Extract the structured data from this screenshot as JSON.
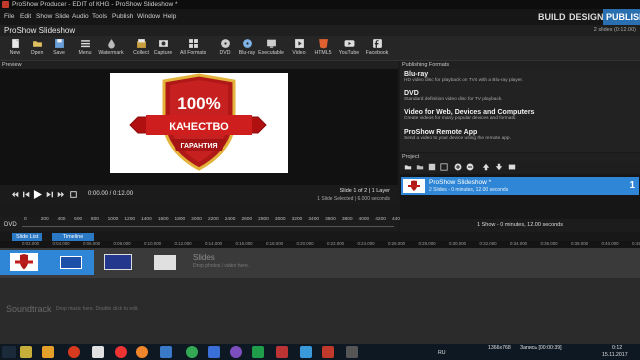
{
  "window": {
    "title": "ProShow Producer - EDIT of КНG - ProShow Slideshow *"
  },
  "menu": {
    "items": [
      "File",
      "Edit",
      "Show",
      "Slide",
      "Audio",
      "Tools",
      "Publish",
      "Window",
      "Help"
    ],
    "modes": [
      "BUILD",
      "DESIGN",
      "PUBLISH"
    ],
    "active_mode": "PUBLISH"
  },
  "project": {
    "name": "ProShow Slideshow",
    "slide_count": "2 slides (0:12.00)"
  },
  "toolbar": {
    "buttons": [
      "New",
      "Open",
      "Save",
      "Menu",
      "Watermark",
      "Collect",
      "Capture",
      "All Formats",
      "DVD",
      "Blu-ray",
      "Executable",
      "Video",
      "HTML5",
      "YouTube",
      "Facebook"
    ]
  },
  "preview": {
    "label": "Preview",
    "time": "0:00.00 / 0:12.00",
    "slide_info": "Slide 1 of 2  |  1 Layer",
    "slide_selected": "1 Slide Selected  |  6.000 seconds",
    "dvd_label": "DVD",
    "badge_top": "100%",
    "badge_ribbon": "КАЧЕСТВО",
    "badge_bottom": "ГАРАНТИЯ"
  },
  "ruler": [
    "0",
    "100",
    "200",
    "300",
    "400",
    "500",
    "600",
    "700",
    "800",
    "900",
    "1000",
    "1100",
    "1200",
    "1300",
    "1400",
    "1500",
    "1600",
    "1700",
    "1800",
    "1900",
    "2000",
    "2100",
    "2200",
    "2300",
    "2400",
    "2500",
    "2600",
    "2700",
    "2800",
    "2900",
    "3000",
    "3100",
    "3200",
    "3300",
    "3400",
    "3500",
    "3600",
    "3700",
    "3800",
    "3900",
    "4000",
    "4100",
    "4200",
    "4300",
    "4400"
  ],
  "publishing": {
    "label": "Publishing Formats",
    "items": [
      {
        "title": "Blu-ray",
        "desc": "HD video disc for playback on TVs with a Blu-ray player."
      },
      {
        "title": "DVD",
        "desc": "Standard definition video disc for TV playback."
      },
      {
        "title": "Video for Web, Devices and Computers",
        "desc": "Create videos for many popular devices and formats."
      },
      {
        "title": "ProShow Remote App",
        "desc": "Send a video to your device using the remote app."
      }
    ]
  },
  "project_panel": {
    "label": "Project",
    "item_name": "ProShow Slideshow *",
    "item_desc": "2 Slides - 0 minutes, 12.00 seconds",
    "item_index": "1",
    "status": "1 Show - 0 minutes, 12.00 seconds"
  },
  "tabs": {
    "slide_list": "Slide List",
    "timeline": "Timeline"
  },
  "timeline_ticks": [
    "0:02.000",
    "0:04.000",
    "0:06.000",
    "0:08.000",
    "0:10.000",
    "0:12.000",
    "0:14.000",
    "0:16.000",
    "0:18.000",
    "0:20.000",
    "0:22.000",
    "0:24.000",
    "0:26.000",
    "0:28.000",
    "0:30.000",
    "0:32.000",
    "0:34.000",
    "0:36.000",
    "0:38.000",
    "0:40.000",
    "0:42.000"
  ],
  "slides_area": {
    "label": "Slides",
    "hint": "Drop photos / video here."
  },
  "soundtrack": {
    "label": "Soundtrack",
    "hint": "Drop music here.  Double click to edit."
  },
  "taskbar": {
    "resolution": "1366x768",
    "recording": "Запись [00:00:39]",
    "lang": "RU",
    "time": "0:12",
    "date": "15.11.2017"
  }
}
